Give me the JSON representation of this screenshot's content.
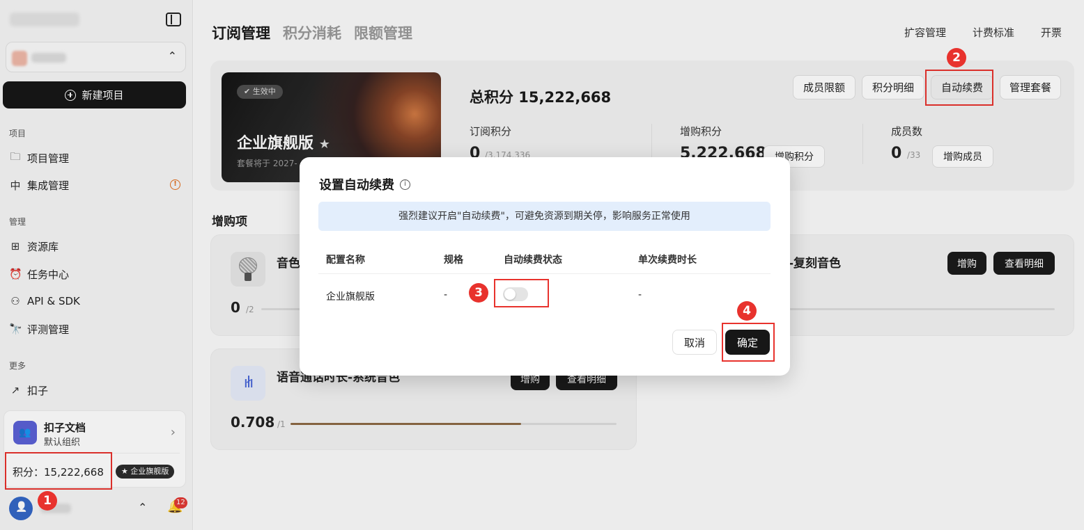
{
  "sidebar": {
    "new_project": "新建项目",
    "sections": [
      {
        "label": "项目",
        "items": [
          "项目管理",
          "集成管理"
        ]
      },
      {
        "label": "管理",
        "items": [
          "资源库",
          "任务中心",
          "API & SDK",
          "评测管理"
        ]
      },
      {
        "label": "更多",
        "items": [
          "扣子"
        ]
      }
    ],
    "org": {
      "name": "扣子文档",
      "sub": "默认组织"
    },
    "points_text": "积分：15,222,668",
    "plan_badge": "企业旗舰版",
    "notification_count": "12"
  },
  "main": {
    "tabs": [
      "订阅管理",
      "积分消耗",
      "限额管理"
    ],
    "top_links": [
      "扩容管理",
      "计费标准",
      "开票"
    ],
    "plan": {
      "status": "生效中",
      "title": "企业旗舰版",
      "sub": "套餐将于 2027-"
    },
    "total_points_label": "总积分 15,222,668",
    "actions": [
      "成员限额",
      "积分明细",
      "自动续费",
      "管理套餐"
    ],
    "stats": [
      {
        "label": "订阅积分",
        "value": "0",
        "sub": "/3,174,336"
      },
      {
        "label": "增购积分",
        "value": "5,222,668",
        "button": "增购积分"
      },
      {
        "label": "成员数",
        "value": "0",
        "sub": "/33",
        "button": "增购成员"
      }
    ],
    "addons_title": "增购项",
    "addons": [
      {
        "title": "音色",
        "value": "0",
        "max": "/2",
        "progress": 0.0
      },
      {
        "title": "-复刻音色",
        "buttons": [
          "增购",
          "查看明细"
        ],
        "progress": 0.06
      },
      {
        "title": "语音通话时长-系统音色",
        "value": "0.708",
        "max": "/1",
        "progress": 0.708,
        "buttons": [
          "增购",
          "查看明细"
        ]
      }
    ]
  },
  "modal": {
    "title": "设置自动续费",
    "notice": "强烈建议开启\"自动续费\"，可避免资源到期关停，影响服务正常使用",
    "headers": [
      "配置名称",
      "规格",
      "自动续费状态",
      "单次续费时长"
    ],
    "row": {
      "name": "企业旗舰版",
      "spec": "-",
      "auto_renew": false,
      "duration": "-"
    },
    "cancel": "取消",
    "confirm": "确定"
  },
  "markers": [
    "1",
    "2",
    "3",
    "4"
  ],
  "colors": {
    "marker_red": "#e8322d",
    "dark_button": "#171717",
    "notice_bg": "#e3eefc"
  }
}
